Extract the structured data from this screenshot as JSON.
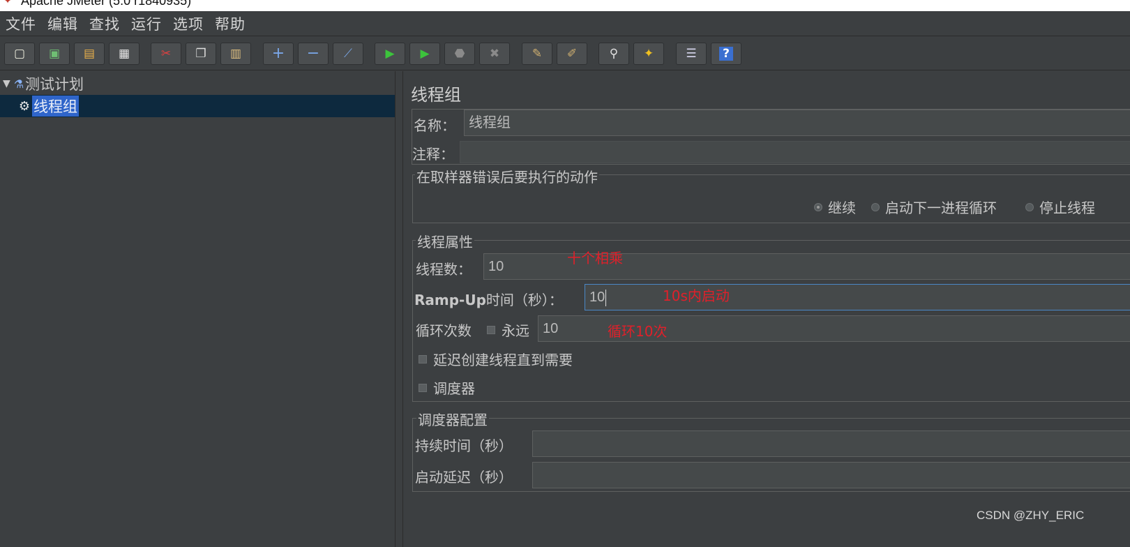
{
  "window": {
    "title": "Apache JMeter (5.0 r1840935)"
  },
  "menu": [
    "文件",
    "编辑",
    "查找",
    "运行",
    "选项",
    "帮助"
  ],
  "toolbar": [
    {
      "name": "new-icon",
      "glyph": "▢"
    },
    {
      "name": "templates-icon",
      "glyph": "▣"
    },
    {
      "name": "open-icon",
      "glyph": "▤"
    },
    {
      "name": "save-icon",
      "glyph": "▦"
    },
    {
      "name": "cut-icon",
      "glyph": "✂"
    },
    {
      "name": "copy-icon",
      "glyph": "❐"
    },
    {
      "name": "paste-icon",
      "glyph": "▥"
    },
    {
      "name": "expand-icon",
      "glyph": "+"
    },
    {
      "name": "collapse-icon",
      "glyph": "−"
    },
    {
      "name": "toggle-icon",
      "glyph": "⟋"
    },
    {
      "name": "start-icon",
      "glyph": "▶"
    },
    {
      "name": "start-no-pause-icon",
      "glyph": "▶"
    },
    {
      "name": "stop-icon",
      "glyph": "⬣"
    },
    {
      "name": "shutdown-icon",
      "glyph": "✖"
    },
    {
      "name": "clear-icon",
      "glyph": "✎"
    },
    {
      "name": "clear-all-icon",
      "glyph": "✐"
    },
    {
      "name": "search-icon",
      "glyph": "⚲"
    },
    {
      "name": "reset-search-icon",
      "glyph": "✦"
    },
    {
      "name": "function-helper-icon",
      "glyph": "☰"
    },
    {
      "name": "help-icon",
      "glyph": "?"
    }
  ],
  "tree": {
    "root_label": "测试计划",
    "child_label": "线程组"
  },
  "panel": {
    "title": "线程组",
    "name_label": "名称：",
    "name_value": "线程组",
    "comment_label": "注释：",
    "comment_value": "",
    "error_group_title": "在取样器错误后要执行的动作",
    "error_options": [
      {
        "label": "继续",
        "checked": true
      },
      {
        "label": "启动下一进程循环",
        "checked": false
      },
      {
        "label": "停止线程",
        "checked": false
      }
    ],
    "thread_group_title": "线程属性",
    "threads_label": "线程数：",
    "threads_value": "10",
    "rampup_bold": "Ramp-Up",
    "rampup_label": "时间（秒）：",
    "rampup_value": "10",
    "loop_label": "循环次数",
    "forever_label": "永远",
    "loop_value": "10",
    "delay_label": "延迟创建线程直到需要",
    "scheduler_label": "调度器",
    "scheduler_group_title": "调度器配置",
    "duration_label": "持续时间（秒）",
    "duration_value": "",
    "startup_delay_label": "启动延迟（秒）",
    "startup_delay_value": ""
  },
  "annotations": {
    "threads_note": "十个相乘",
    "rampup_note": "10s内启动",
    "loop_note": "循环10次"
  },
  "watermark": "CSDN @ZHY_ERIC",
  "colors": {
    "background": "#3c3f41",
    "selection": "#2f65ca",
    "annotation": "#e0202a"
  }
}
